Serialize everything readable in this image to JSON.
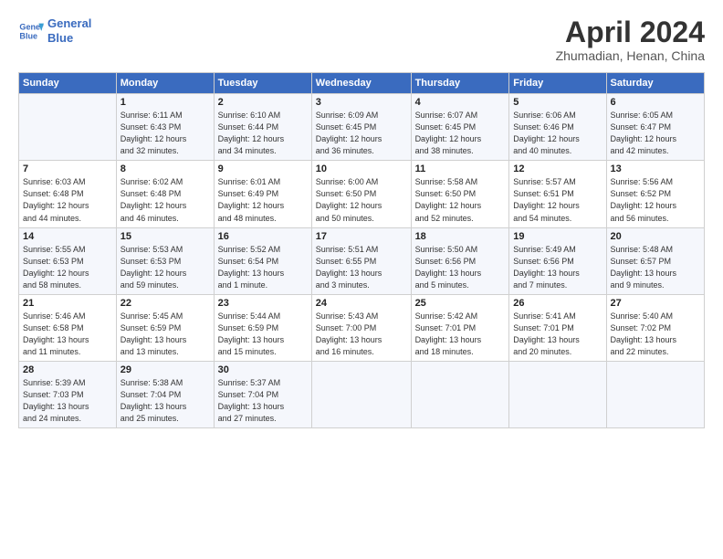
{
  "header": {
    "logo_line1": "General",
    "logo_line2": "Blue",
    "title": "April 2024",
    "location": "Zhumadian, Henan, China"
  },
  "weekdays": [
    "Sunday",
    "Monday",
    "Tuesday",
    "Wednesday",
    "Thursday",
    "Friday",
    "Saturday"
  ],
  "weeks": [
    [
      {
        "day": "",
        "info": ""
      },
      {
        "day": "1",
        "info": "Sunrise: 6:11 AM\nSunset: 6:43 PM\nDaylight: 12 hours\nand 32 minutes."
      },
      {
        "day": "2",
        "info": "Sunrise: 6:10 AM\nSunset: 6:44 PM\nDaylight: 12 hours\nand 34 minutes."
      },
      {
        "day": "3",
        "info": "Sunrise: 6:09 AM\nSunset: 6:45 PM\nDaylight: 12 hours\nand 36 minutes."
      },
      {
        "day": "4",
        "info": "Sunrise: 6:07 AM\nSunset: 6:45 PM\nDaylight: 12 hours\nand 38 minutes."
      },
      {
        "day": "5",
        "info": "Sunrise: 6:06 AM\nSunset: 6:46 PM\nDaylight: 12 hours\nand 40 minutes."
      },
      {
        "day": "6",
        "info": "Sunrise: 6:05 AM\nSunset: 6:47 PM\nDaylight: 12 hours\nand 42 minutes."
      }
    ],
    [
      {
        "day": "7",
        "info": "Sunrise: 6:03 AM\nSunset: 6:48 PM\nDaylight: 12 hours\nand 44 minutes."
      },
      {
        "day": "8",
        "info": "Sunrise: 6:02 AM\nSunset: 6:48 PM\nDaylight: 12 hours\nand 46 minutes."
      },
      {
        "day": "9",
        "info": "Sunrise: 6:01 AM\nSunset: 6:49 PM\nDaylight: 12 hours\nand 48 minutes."
      },
      {
        "day": "10",
        "info": "Sunrise: 6:00 AM\nSunset: 6:50 PM\nDaylight: 12 hours\nand 50 minutes."
      },
      {
        "day": "11",
        "info": "Sunrise: 5:58 AM\nSunset: 6:50 PM\nDaylight: 12 hours\nand 52 minutes."
      },
      {
        "day": "12",
        "info": "Sunrise: 5:57 AM\nSunset: 6:51 PM\nDaylight: 12 hours\nand 54 minutes."
      },
      {
        "day": "13",
        "info": "Sunrise: 5:56 AM\nSunset: 6:52 PM\nDaylight: 12 hours\nand 56 minutes."
      }
    ],
    [
      {
        "day": "14",
        "info": "Sunrise: 5:55 AM\nSunset: 6:53 PM\nDaylight: 12 hours\nand 58 minutes."
      },
      {
        "day": "15",
        "info": "Sunrise: 5:53 AM\nSunset: 6:53 PM\nDaylight: 12 hours\nand 59 minutes."
      },
      {
        "day": "16",
        "info": "Sunrise: 5:52 AM\nSunset: 6:54 PM\nDaylight: 13 hours\nand 1 minute."
      },
      {
        "day": "17",
        "info": "Sunrise: 5:51 AM\nSunset: 6:55 PM\nDaylight: 13 hours\nand 3 minutes."
      },
      {
        "day": "18",
        "info": "Sunrise: 5:50 AM\nSunset: 6:56 PM\nDaylight: 13 hours\nand 5 minutes."
      },
      {
        "day": "19",
        "info": "Sunrise: 5:49 AM\nSunset: 6:56 PM\nDaylight: 13 hours\nand 7 minutes."
      },
      {
        "day": "20",
        "info": "Sunrise: 5:48 AM\nSunset: 6:57 PM\nDaylight: 13 hours\nand 9 minutes."
      }
    ],
    [
      {
        "day": "21",
        "info": "Sunrise: 5:46 AM\nSunset: 6:58 PM\nDaylight: 13 hours\nand 11 minutes."
      },
      {
        "day": "22",
        "info": "Sunrise: 5:45 AM\nSunset: 6:59 PM\nDaylight: 13 hours\nand 13 minutes."
      },
      {
        "day": "23",
        "info": "Sunrise: 5:44 AM\nSunset: 6:59 PM\nDaylight: 13 hours\nand 15 minutes."
      },
      {
        "day": "24",
        "info": "Sunrise: 5:43 AM\nSunset: 7:00 PM\nDaylight: 13 hours\nand 16 minutes."
      },
      {
        "day": "25",
        "info": "Sunrise: 5:42 AM\nSunset: 7:01 PM\nDaylight: 13 hours\nand 18 minutes."
      },
      {
        "day": "26",
        "info": "Sunrise: 5:41 AM\nSunset: 7:01 PM\nDaylight: 13 hours\nand 20 minutes."
      },
      {
        "day": "27",
        "info": "Sunrise: 5:40 AM\nSunset: 7:02 PM\nDaylight: 13 hours\nand 22 minutes."
      }
    ],
    [
      {
        "day": "28",
        "info": "Sunrise: 5:39 AM\nSunset: 7:03 PM\nDaylight: 13 hours\nand 24 minutes."
      },
      {
        "day": "29",
        "info": "Sunrise: 5:38 AM\nSunset: 7:04 PM\nDaylight: 13 hours\nand 25 minutes."
      },
      {
        "day": "30",
        "info": "Sunrise: 5:37 AM\nSunset: 7:04 PM\nDaylight: 13 hours\nand 27 minutes."
      },
      {
        "day": "",
        "info": ""
      },
      {
        "day": "",
        "info": ""
      },
      {
        "day": "",
        "info": ""
      },
      {
        "day": "",
        "info": ""
      }
    ]
  ]
}
